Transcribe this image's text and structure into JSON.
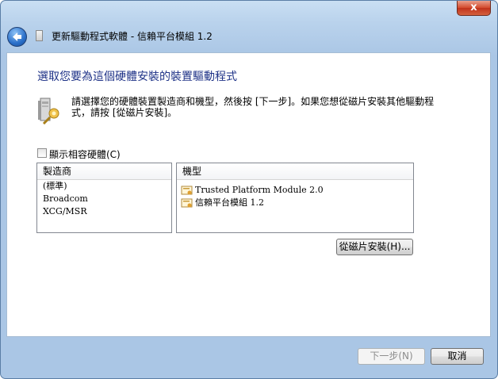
{
  "window": {
    "title": "更新驅動程式軟體 - 信賴平台模組 1.2",
    "close_glyph": "x"
  },
  "page": {
    "heading": "選取您要為這個硬體安裝的裝置驅動程式",
    "instruction": "請選擇您的硬體裝置製造商和機型，然後按 [下一步]。如果您想從磁片安裝其他驅動程式，請按 [從磁片安裝]。"
  },
  "compatible_checkbox": {
    "label": "顯示相容硬體(C)",
    "checked": false
  },
  "manufacturer_list": {
    "header": "製造商",
    "items": [
      "(標準)",
      "Broadcom",
      "XCG/MSR"
    ]
  },
  "model_list": {
    "header": "機型",
    "items": [
      "Trusted Platform Module 2.0",
      "信賴平台模組 1.2"
    ]
  },
  "buttons": {
    "have_disk": "從磁片安裝(H)...",
    "next": "下一步(N)",
    "cancel": "取消"
  },
  "icons": {
    "back": "back-arrow-icon",
    "title": "chip-icon",
    "hardware": "hardware-install-icon",
    "model": "driver-certificate-icon"
  },
  "colors": {
    "heading": "#1e3287",
    "close_button": "#c0321b",
    "frame": "#b9d2ec"
  }
}
